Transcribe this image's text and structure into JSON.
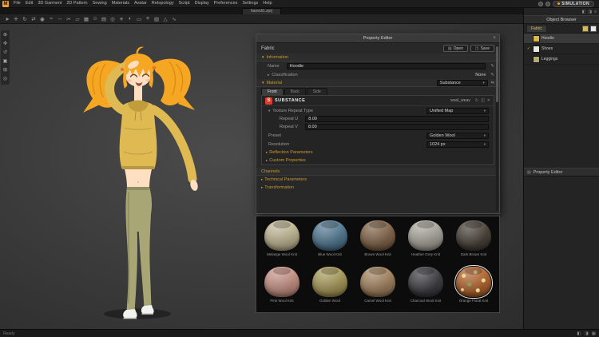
{
  "app": {
    "logo_letter": "M",
    "menus": [
      "File",
      "Edit",
      "3D Garment",
      "2D Pattern",
      "Sewing",
      "Materials",
      "Avatar",
      "Retopology",
      "Script",
      "Display",
      "Preferences",
      "Settings",
      "Help"
    ],
    "document_tab": "hanedi1.zprj",
    "simulation_label": "SIMULATION",
    "status_left": "Ready",
    "accent_color": "#f0a028"
  },
  "toolbar": {
    "icons": [
      {
        "name": "select-tool-icon",
        "glyph": "➤"
      },
      {
        "name": "move-tool-icon",
        "glyph": "✛"
      },
      {
        "name": "rotate-tool-icon",
        "glyph": "↻"
      },
      {
        "name": "mirror-tool-icon",
        "glyph": "⇄"
      },
      {
        "name": "pin-tool-icon",
        "glyph": "◉"
      },
      {
        "name": "sewing-tool-icon",
        "glyph": "≈"
      },
      {
        "name": "measure-tool-icon",
        "glyph": "↔"
      },
      {
        "name": "scissors-tool-icon",
        "glyph": "✂"
      },
      {
        "name": "pattern-tool-icon",
        "glyph": "▱"
      },
      {
        "name": "grid-tool-icon",
        "glyph": "▦"
      },
      {
        "name": "avatar-tool-icon",
        "glyph": "☺"
      },
      {
        "name": "arrange-tool-icon",
        "glyph": "▤"
      },
      {
        "name": "camera-tool-icon",
        "glyph": "◎"
      },
      {
        "name": "light-tool-icon",
        "glyph": "☀"
      },
      {
        "name": "render-tool-icon",
        "glyph": "◐"
      },
      {
        "name": "flatten-tool-icon",
        "glyph": "▭"
      },
      {
        "name": "layers-tool-icon",
        "glyph": "≡"
      },
      {
        "name": "texture-tool-icon",
        "glyph": "▨"
      },
      {
        "name": "triangle-tool-icon",
        "glyph": "△"
      },
      {
        "name": "wind-tool-icon",
        "glyph": "∿"
      }
    ]
  },
  "side_toolbar": {
    "icons": [
      {
        "name": "zoom-tool-icon",
        "glyph": "⊕"
      },
      {
        "name": "pan-tool-icon",
        "glyph": "✜"
      },
      {
        "name": "orbit-tool-icon",
        "glyph": "↺"
      },
      {
        "name": "frame-view-icon",
        "glyph": "▣"
      },
      {
        "name": "gizmo-tool-icon",
        "glyph": "⊞"
      },
      {
        "name": "snapshot-tool-icon",
        "glyph": "◎"
      }
    ]
  },
  "viewport": {
    "character": {
      "hair_color": "#f5a623",
      "skin_color": "#ffdfc2",
      "hoodie_color": "#dfba52",
      "leggings_color": "#a9a676",
      "shoe_color": "#f2f2ee"
    }
  },
  "property_editor": {
    "title": "Property Editor",
    "close_glyph": "×",
    "fabric_label": "Fabric",
    "open_button": "Open",
    "save_button": "Save",
    "information_header": "Information",
    "name_label": "Name",
    "name_value": "Hoodie",
    "classification_label": "Classification",
    "classification_value": "None",
    "material_header": "Material",
    "material_type": "Substance",
    "material_tabs": [
      "Front",
      "Back",
      "Side"
    ],
    "substance_brand": "SUBSTANCE",
    "substance_file": "wool_weav",
    "texture_repeat_label": "Texture Repeat Type",
    "texture_repeat_value": "Unified Map",
    "repeat_u_label": "Repeat U",
    "repeat_u_value": "8.00",
    "repeat_v_label": "Repeat V",
    "repeat_v_value": "8.00",
    "preset_label": "Preset",
    "preset_value": "Golden Wool",
    "resolution_label": "Resolution",
    "resolution_value": "1024 px",
    "reflection_header": "Reflection Parameters",
    "custom_header": "Custom Properties",
    "channels_header": "Channels",
    "technical_header": "Technical Parameters",
    "transformation_header": "Transformation"
  },
  "material_grid": {
    "items": [
      {
        "name": "Melange Wool Knit",
        "color": "#cfc49e"
      },
      {
        "name": "Blue Wool Knit",
        "color": "#56809c"
      },
      {
        "name": "Brown Wool Knit",
        "color": "#8a6a4c"
      },
      {
        "name": "Heather Grey Knit",
        "color": "#b4b0a6"
      },
      {
        "name": "Dark Brown Knit",
        "color": "#4d443c"
      },
      {
        "name": "Pink Wool Knit",
        "color": "#d49a8c"
      },
      {
        "name": "Golden Wool",
        "color": "#b2a35c"
      },
      {
        "name": "Camel Wool Knit",
        "color": "#ad8a62"
      },
      {
        "name": "Charcoal Wool Knit",
        "color": "#3f3f45"
      },
      {
        "name": "Orange Floral Knit",
        "color": "#c06a30",
        "selected": true,
        "cls": "floral"
      }
    ]
  },
  "object_browser": {
    "title": "Object Browser",
    "tab_label": "Fabric",
    "items": [
      {
        "name": "Hoodie",
        "color": "#d9b94e",
        "active": true
      },
      {
        "name": "Shoes",
        "color": "#e8e8e2",
        "checked": true
      },
      {
        "name": "Leggings",
        "color": "#b3ab7c"
      }
    ],
    "bottom_panel_title": "Property Editor"
  },
  "statusbar": {
    "icons": [
      {
        "name": "single-view-icon",
        "glyph": "◧"
      },
      {
        "name": "split-view-icon",
        "glyph": "◨"
      },
      {
        "name": "quad-view-icon",
        "glyph": "▦"
      }
    ]
  }
}
